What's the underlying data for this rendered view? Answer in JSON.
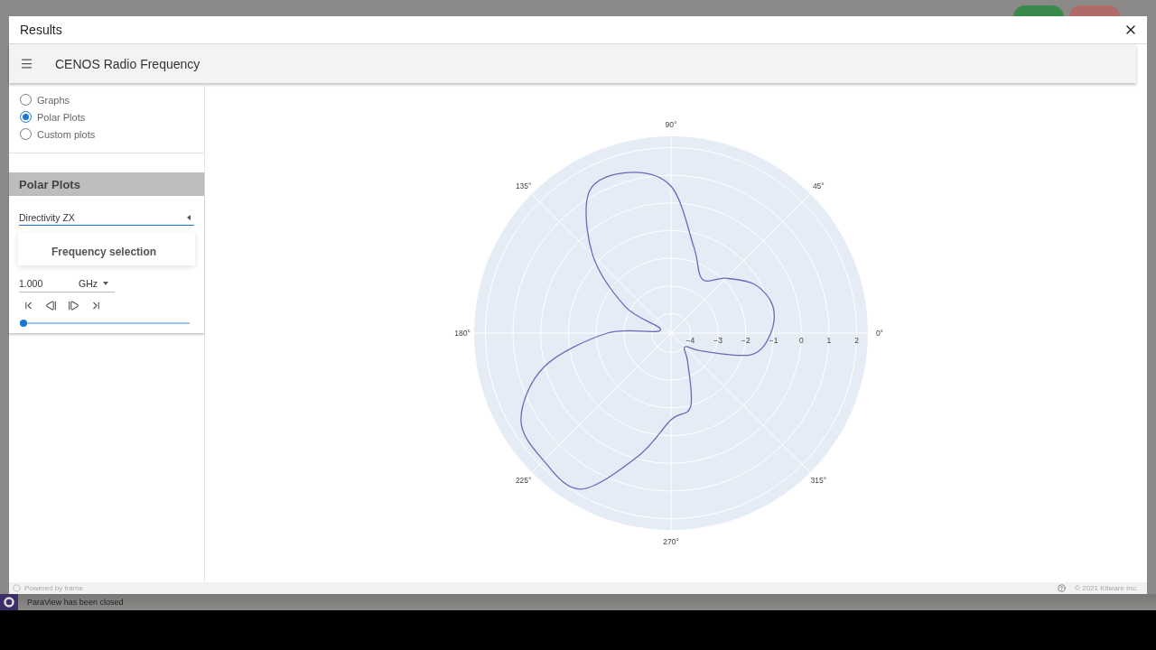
{
  "dialog": {
    "title": "Results"
  },
  "toolbar": {
    "title": "CENOS Radio Frequency"
  },
  "plot_types": [
    {
      "label": "Graphs",
      "selected": false
    },
    {
      "label": "Polar Plots",
      "selected": true
    },
    {
      "label": "Custom plots",
      "selected": false
    }
  ],
  "panel": {
    "title": "Polar Plots",
    "select": {
      "value": "Directivity ZX"
    },
    "frequency": {
      "title": "Frequency selection",
      "value": "1.000",
      "unit": "GHz"
    },
    "slider": {
      "level": 0
    }
  },
  "polar_plot": {
    "angle_labels": [
      "0°",
      "45°",
      "90°",
      "135°",
      "180°",
      "225°",
      "270°",
      "315°"
    ],
    "radius_labels": [
      "−4",
      "−3",
      "−2",
      "−1",
      "0",
      "1",
      "2"
    ]
  },
  "footer": {
    "left": "Powered by trame",
    "right": "© 2021 Kitware Inc."
  },
  "status_bar": {
    "message": "ParaView has been closed"
  }
}
